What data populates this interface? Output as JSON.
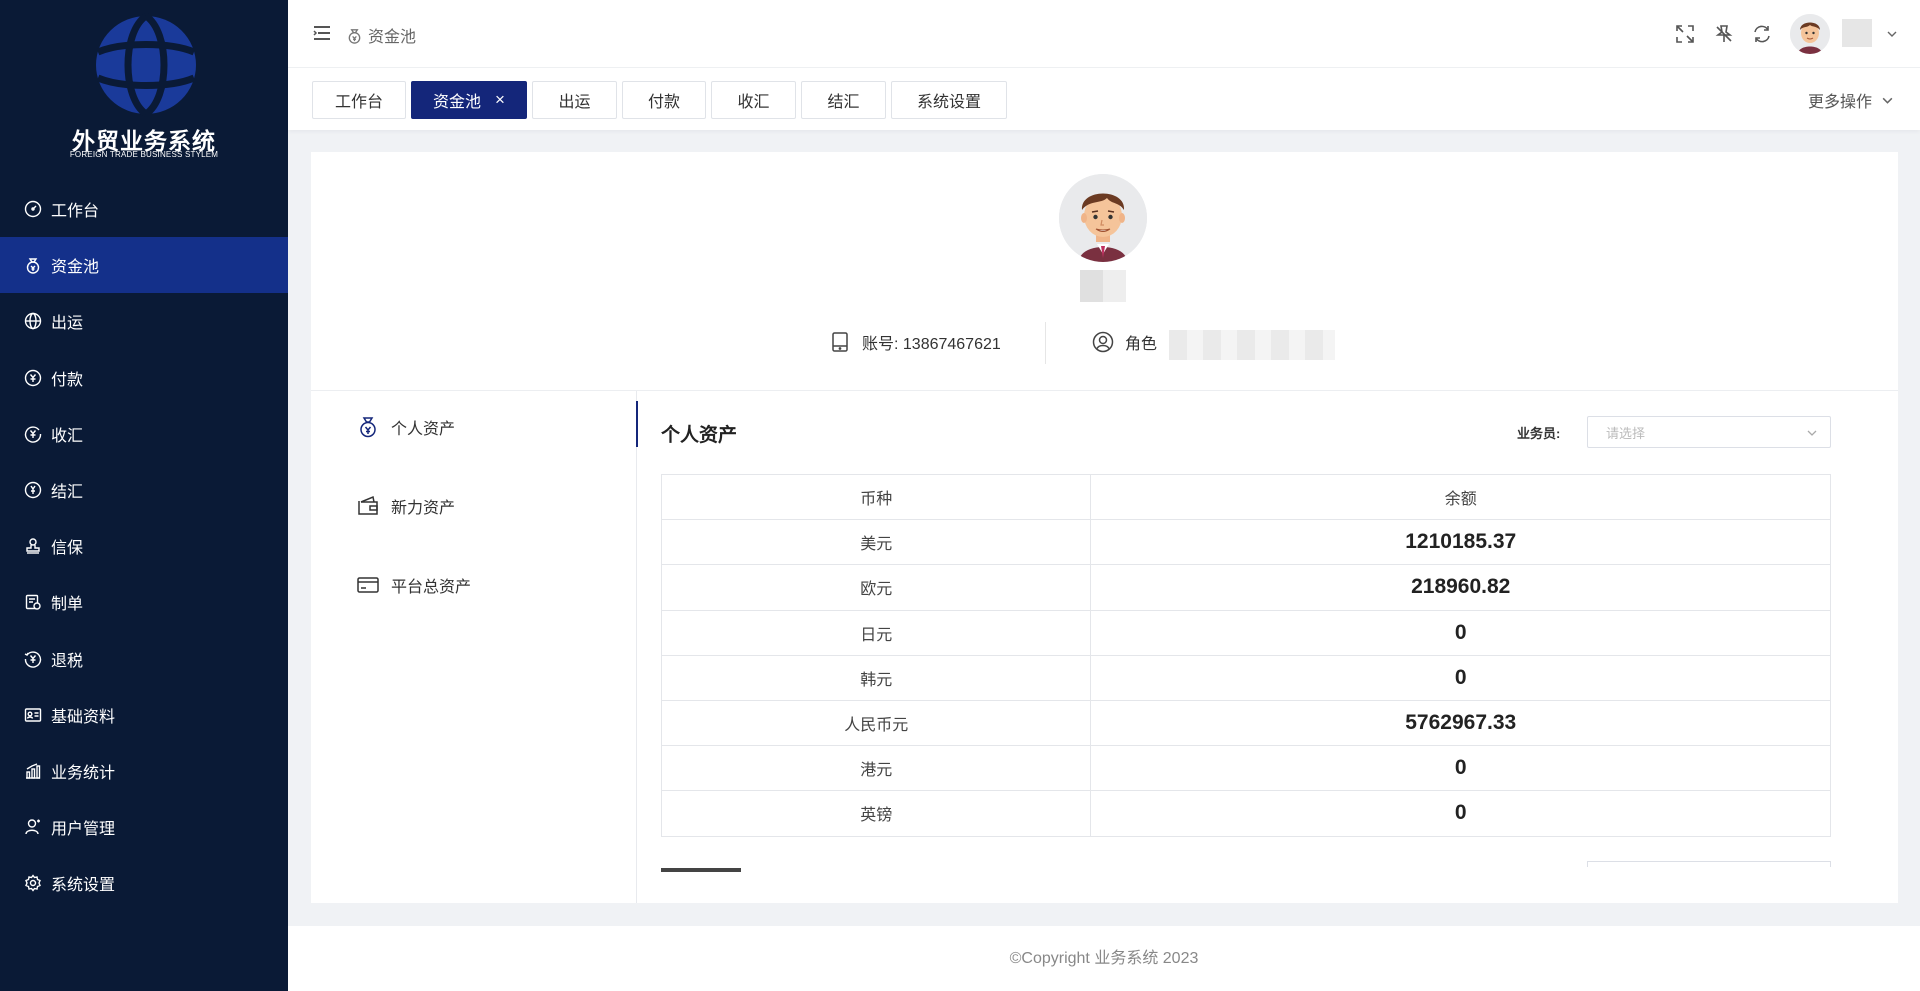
{
  "logo": {
    "title": "外贸业务系统",
    "subtitle": "FOREIGN TRADE BUSINESS STYLEM"
  },
  "sidebar": {
    "items": [
      {
        "label": "工作台",
        "icon": "dashboard-icon",
        "active": false
      },
      {
        "label": "资金池",
        "icon": "money-bag-icon",
        "active": true
      },
      {
        "label": "出运",
        "icon": "globe-icon",
        "active": false
      },
      {
        "label": "付款",
        "icon": "yuan-coin-icon",
        "active": false
      },
      {
        "label": "收汇",
        "icon": "yuan-receive-icon",
        "active": false
      },
      {
        "label": "结汇",
        "icon": "exchange-icon",
        "active": false
      },
      {
        "label": "信保",
        "icon": "stamp-icon",
        "active": false
      },
      {
        "label": "制单",
        "icon": "document-icon",
        "active": false
      },
      {
        "label": "退税",
        "icon": "tax-refund-icon",
        "active": false
      },
      {
        "label": "基础资料",
        "icon": "id-card-icon",
        "active": false
      },
      {
        "label": "业务统计",
        "icon": "chart-icon",
        "active": false
      },
      {
        "label": "用户管理",
        "icon": "user-icon",
        "active": false
      },
      {
        "label": "系统设置",
        "icon": "settings-icon",
        "active": false
      }
    ]
  },
  "header": {
    "breadcrumb": "资金池"
  },
  "tabs": [
    {
      "label": "工作台",
      "active": false
    },
    {
      "label": "资金池",
      "active": true,
      "close": "×"
    },
    {
      "label": "出运",
      "active": false
    },
    {
      "label": "付款",
      "active": false
    },
    {
      "label": "收汇",
      "active": false
    },
    {
      "label": "结汇",
      "active": false
    },
    {
      "label": "系统设置",
      "active": false
    }
  ],
  "more_ops": "更多操作",
  "profile": {
    "account_label": "账号: 13867467621",
    "role_label": "角色"
  },
  "leftnav": [
    {
      "label": "个人资产",
      "icon": "money-bag-icon",
      "active": true
    },
    {
      "label": "新力资产",
      "icon": "wallet-icon",
      "active": false
    },
    {
      "label": "平台总资产",
      "icon": "card-icon",
      "active": false
    }
  ],
  "assets": {
    "title": "个人资产",
    "sales_label": "业务员:",
    "sales_placeholder": "请选择",
    "headers": [
      "币种",
      "余额"
    ],
    "rows": [
      {
        "currency": "美元",
        "amount": "1210185.37"
      },
      {
        "currency": "欧元",
        "amount": "218960.82"
      },
      {
        "currency": "日元",
        "amount": "0"
      },
      {
        "currency": "韩元",
        "amount": "0"
      },
      {
        "currency": "人民币元",
        "amount": "5762967.33"
      },
      {
        "currency": "港元",
        "amount": "0"
      },
      {
        "currency": "英镑",
        "amount": "0"
      }
    ]
  },
  "footer": "©Copyright 业务系统 2023",
  "colors": {
    "sidebar_bg": "#0a1a36",
    "sidebar_active": "#14308a",
    "tab_active": "#14267a"
  }
}
